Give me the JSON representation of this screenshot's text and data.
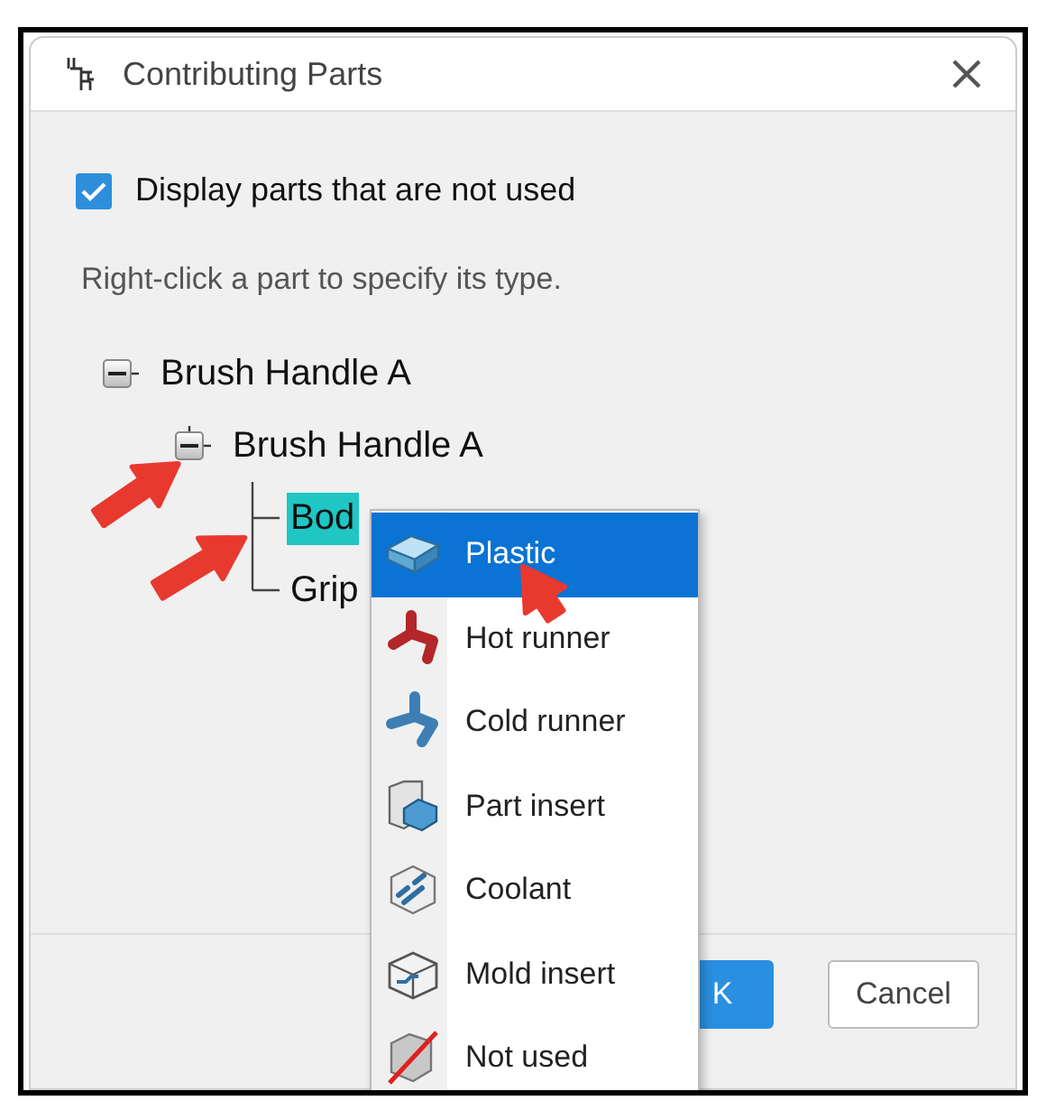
{
  "window": {
    "title": "Contributing Parts"
  },
  "checkbox": {
    "label": "Display parts that are not used",
    "checked": true
  },
  "hint": "Right-click a part to specify its type.",
  "tree": [
    {
      "label": "Brush Handle A",
      "expanded": true,
      "selected": false,
      "children": [
        {
          "label": "Brush Handle A",
          "expanded": true,
          "selected": false,
          "children": [
            {
              "label": "Bod",
              "selected": true
            },
            {
              "label": "Grip",
              "selected": false
            }
          ]
        }
      ]
    }
  ],
  "context_menu": {
    "items": [
      {
        "label": "Plastic",
        "kind": "plastic",
        "selected": true
      },
      {
        "label": "Hot runner",
        "kind": "hot_runner",
        "selected": false
      },
      {
        "label": "Cold runner",
        "kind": "cold_runner",
        "selected": false
      },
      {
        "label": "Part insert",
        "kind": "part_insert",
        "selected": false
      },
      {
        "label": "Coolant",
        "kind": "coolant",
        "selected": false
      },
      {
        "label": "Mold insert",
        "kind": "mold_insert",
        "selected": false
      },
      {
        "label": "Not used",
        "kind": "not_used",
        "selected": false
      }
    ]
  },
  "buttons": [
    {
      "label": "K",
      "kind": "primary"
    },
    {
      "label": "Cancel",
      "kind": "secondary"
    }
  ]
}
